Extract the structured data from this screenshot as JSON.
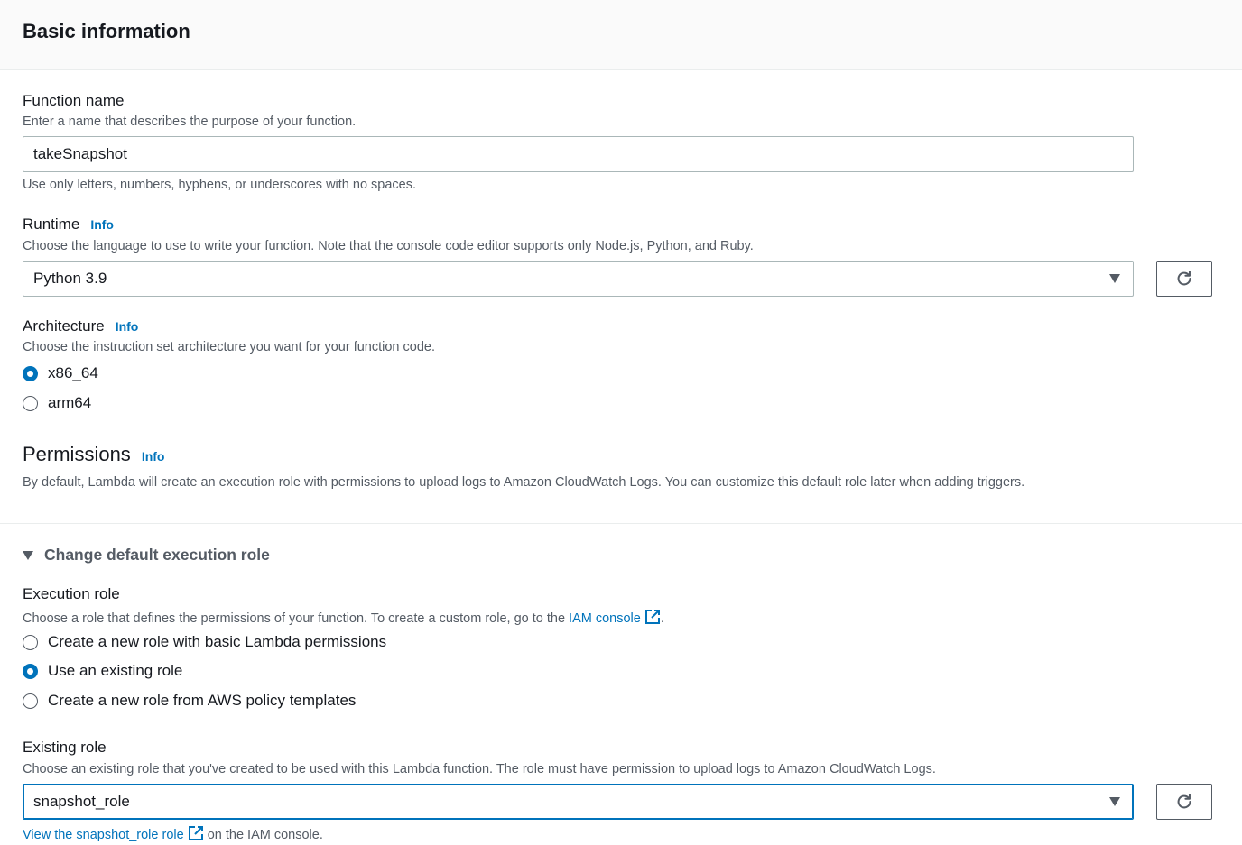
{
  "header": {
    "title": "Basic information"
  },
  "function_name": {
    "label": "Function name",
    "description": "Enter a name that describes the purpose of your function.",
    "value": "takeSnapshot",
    "constraint": "Use only letters, numbers, hyphens, or underscores with no spaces."
  },
  "runtime": {
    "label": "Runtime",
    "info": "Info",
    "description": "Choose the language to use to write your function. Note that the console code editor supports only Node.js, Python, and Ruby.",
    "selected": "Python 3.9"
  },
  "architecture": {
    "label": "Architecture",
    "info": "Info",
    "description": "Choose the instruction set architecture you want for your function code.",
    "options": [
      {
        "label": "x86_64",
        "checked": true
      },
      {
        "label": "arm64",
        "checked": false
      }
    ]
  },
  "permissions": {
    "title": "Permissions",
    "info": "Info",
    "description": "By default, Lambda will create an execution role with permissions to upload logs to Amazon CloudWatch Logs. You can customize this default role later when adding triggers."
  },
  "expander": {
    "label": "Change default execution role",
    "expanded": true
  },
  "execution_role": {
    "label": "Execution role",
    "description_prefix": "Choose a role that defines the permissions of your function. To create a custom role, go to the ",
    "link": "IAM console",
    "description_suffix": ".",
    "options": [
      {
        "label": "Create a new role with basic Lambda permissions",
        "checked": false
      },
      {
        "label": "Use an existing role",
        "checked": true
      },
      {
        "label": "Create a new role from AWS policy templates",
        "checked": false
      }
    ]
  },
  "existing_role": {
    "label": "Existing role",
    "description": "Choose an existing role that you've created to be used with this Lambda function. The role must have permission to upload logs to Amazon CloudWatch Logs.",
    "selected": "snapshot_role",
    "view_link": "View the snapshot_role role",
    "view_suffix": " on the IAM console."
  },
  "icons": {
    "refresh": "refresh-icon",
    "caret": "caret-down-icon",
    "external": "external-link-icon",
    "expander": "triangle-down-icon"
  },
  "colors": {
    "accent": "#0073bb",
    "text": "#16191f",
    "muted": "#545b64",
    "header_bg": "#fafafa"
  }
}
